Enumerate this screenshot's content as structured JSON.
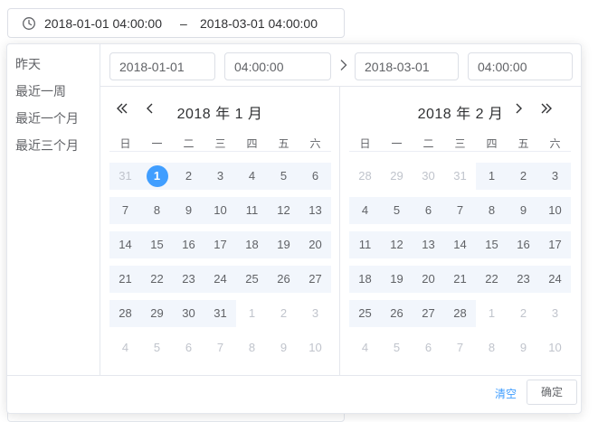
{
  "range_input": {
    "start": "2018-01-01 04:00:00",
    "separator": "–",
    "end": "2018-03-01 04:00:00"
  },
  "shortcuts": [
    "昨天",
    "最近一周",
    "最近一个月",
    "最近三个月"
  ],
  "time_header": {
    "start_date": "2018-01-01",
    "start_time": "04:00:00",
    "end_date": "2018-03-01",
    "end_time": "04:00:00"
  },
  "left_calendar": {
    "title": "2018 年  1 月",
    "weekdays": [
      "日",
      "一",
      "二",
      "三",
      "四",
      "五",
      "六"
    ],
    "rows": [
      [
        "31",
        "1",
        "2",
        "3",
        "4",
        "5",
        "6"
      ],
      [
        "7",
        "8",
        "9",
        "10",
        "11",
        "12",
        "13"
      ],
      [
        "14",
        "15",
        "16",
        "17",
        "18",
        "19",
        "20"
      ],
      [
        "21",
        "22",
        "23",
        "24",
        "25",
        "26",
        "27"
      ],
      [
        "28",
        "29",
        "30",
        "31",
        "1",
        "2",
        "3"
      ],
      [
        "4",
        "5",
        "6",
        "7",
        "8",
        "9",
        "10"
      ]
    ]
  },
  "right_calendar": {
    "title": "2018 年  2 月",
    "weekdays": [
      "日",
      "一",
      "二",
      "三",
      "四",
      "五",
      "六"
    ],
    "rows": [
      [
        "28",
        "29",
        "30",
        "31",
        "1",
        "2",
        "3"
      ],
      [
        "4",
        "5",
        "6",
        "7",
        "8",
        "9",
        "10"
      ],
      [
        "11",
        "12",
        "13",
        "14",
        "15",
        "16",
        "17"
      ],
      [
        "18",
        "19",
        "20",
        "21",
        "22",
        "23",
        "24"
      ],
      [
        "25",
        "26",
        "27",
        "28",
        "1",
        "2",
        "3"
      ],
      [
        "4",
        "5",
        "6",
        "7",
        "8",
        "9",
        "10"
      ]
    ]
  },
  "footer": {
    "clear_label": "清空",
    "confirm_label": "确定"
  },
  "colors": {
    "accent": "#409eff",
    "range_bg": "#f2f6fc",
    "muted_text": "#c0c4cc"
  }
}
